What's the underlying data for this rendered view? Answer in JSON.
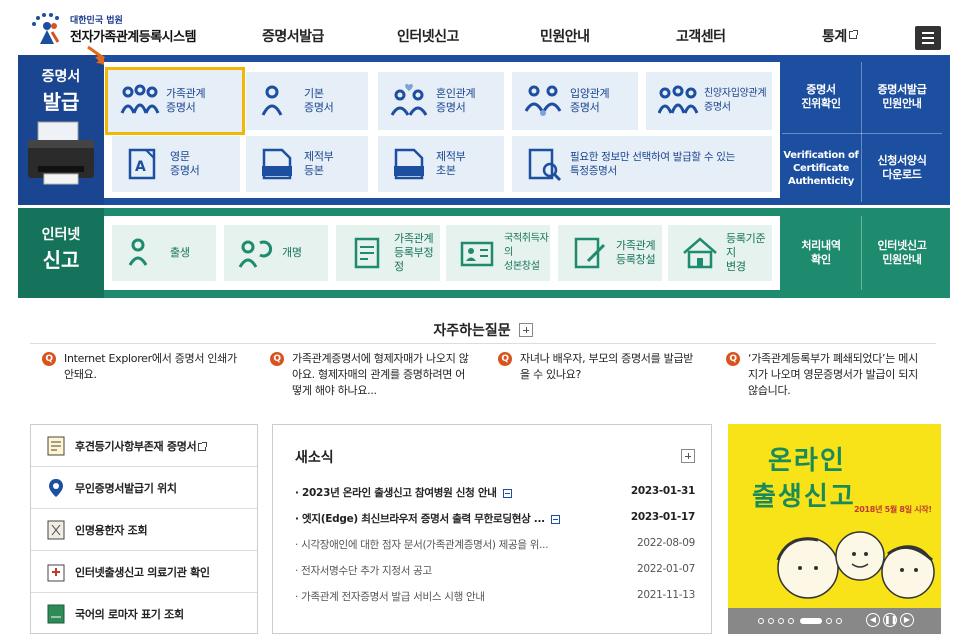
{
  "header": {
    "logo_sub": "대한민국 법원",
    "logo_main": "전자가족관계등록시스템",
    "nav": [
      {
        "label": "증명서발급"
      },
      {
        "label": "인터넷신고"
      },
      {
        "label": "민원안내"
      },
      {
        "label": "고객센터"
      },
      {
        "label": "통계"
      }
    ]
  },
  "certificate": {
    "label_line1": "증명서",
    "label_line2": "발급",
    "tiles": [
      {
        "line1": "가족관계",
        "line2": "증명서",
        "icon": "family-icon"
      },
      {
        "line1": "기본",
        "line2": "증명서",
        "icon": "person-icon"
      },
      {
        "line1": "혼인관계",
        "line2": "증명서",
        "icon": "couple-heart-icon"
      },
      {
        "line1": "입양관계",
        "line2": "증명서",
        "icon": "adoption-icon"
      },
      {
        "line1": "친양자입양관계",
        "line2": "증명서",
        "icon": "family-group-icon"
      },
      {
        "line1": "영문",
        "line2": "증명서",
        "icon": "english-doc-icon"
      },
      {
        "line1": "제적부",
        "line2": "등본",
        "icon": "removed-register-icon"
      },
      {
        "line1": "제적부",
        "line2": "초본",
        "icon": "removed-register-icon"
      },
      {
        "line1": "필요한 정보만 선택하여 발급할 수 있는",
        "line2": "특정증명서",
        "icon": "doc-search-icon"
      }
    ],
    "side": [
      {
        "line1": "증명서",
        "line2": "진위확인"
      },
      {
        "line1": "증명서발급",
        "line2": "민원안내"
      },
      {
        "line1": "Verification of",
        "line2": "Certificate",
        "line3": "Authenticity"
      },
      {
        "line1": "신청서양식",
        "line2": "다운로드"
      }
    ]
  },
  "report": {
    "label_line1": "인터넷",
    "label_line2": "신고",
    "tiles": [
      {
        "line1": "출생",
        "line2": "",
        "icon": "baby-icon"
      },
      {
        "line1": "개명",
        "line2": "",
        "icon": "rename-icon"
      },
      {
        "line1": "가족관계",
        "line2": "등록부정정",
        "icon": "doc-edit-icon"
      },
      {
        "line1": "국적취득자의",
        "line2": "성본창설",
        "icon": "id-card-icon"
      },
      {
        "line1": "가족관계",
        "line2": "등록창설",
        "icon": "doc-write-icon"
      },
      {
        "line1": "등록기준지",
        "line2": "변경",
        "icon": "house-icon"
      }
    ],
    "side": [
      {
        "line1": "처리내역",
        "line2": "확인"
      },
      {
        "line1": "인터넷신고",
        "line2": "민원안내"
      }
    ]
  },
  "faq": {
    "title": "자주하는질문",
    "items": [
      {
        "q": "Q",
        "text": "Internet Explorer에서 증명서 인쇄가 안돼요."
      },
      {
        "q": "Q",
        "text": "가족관계증명서에 형제자매가 나오지 않아요. 형제자매의 관계를 증명하려면 어떻게 해야 하나요..."
      },
      {
        "q": "Q",
        "text": "자녀나 배우자, 부모의 증명서를 발급받을 수 있나요?"
      },
      {
        "q": "Q",
        "text": "‘가족관계등록부가 폐쇄되었다’는 메시지가 나오며 영문증명서가 발급이 되지 않습니다."
      }
    ]
  },
  "quick_links": [
    {
      "label": "후견등기사항부존재 증명서",
      "icon": "certificate-doc-icon",
      "external": true
    },
    {
      "label": "무인증명서발급기 위치",
      "icon": "location-pin-icon",
      "external": false
    },
    {
      "label": "인명용한자 조회",
      "icon": "hanja-book-icon",
      "external": false
    },
    {
      "label": "인터넷출생신고 의료기관 확인",
      "icon": "hospital-icon",
      "external": false
    },
    {
      "label": "국어의 로마자 표기 조회",
      "icon": "green-book-icon",
      "external": false
    }
  ],
  "news": {
    "title": "새소식",
    "items": [
      {
        "title": "2023년 온라인 출생신고 참여병원 신청 안내",
        "date": "2023-01-31",
        "is_new": true
      },
      {
        "title": "엣지(Edge) 최신브라우저 증명서 출력 무한로딩현상 ...",
        "date": "2023-01-17",
        "is_new": true
      },
      {
        "title": "시각장애인에 대한 점자 문서(가족관계증명서) 제공을 위...",
        "date": "2022-08-09",
        "is_new": false
      },
      {
        "title": "전자서명수단 추가 지정서 공고",
        "date": "2022-01-07",
        "is_new": false
      },
      {
        "title": "가족관계 전자증명서 발급 서비스 시행 안내",
        "date": "2021-11-13",
        "is_new": false
      }
    ]
  },
  "banner": {
    "line1": "온라인",
    "line2": "출생신고",
    "date_text": "2018년 5월 8일 시작!",
    "pause_symbol": "❚❚",
    "prev_symbol": "◀",
    "next_symbol": "▶"
  },
  "colors": {
    "cert_band": "#1d4fa0",
    "report_band": "#1e8a6e",
    "highlight": "#f2b705",
    "faq_q": "#d9531e",
    "banner_bg": "#f7e318"
  }
}
